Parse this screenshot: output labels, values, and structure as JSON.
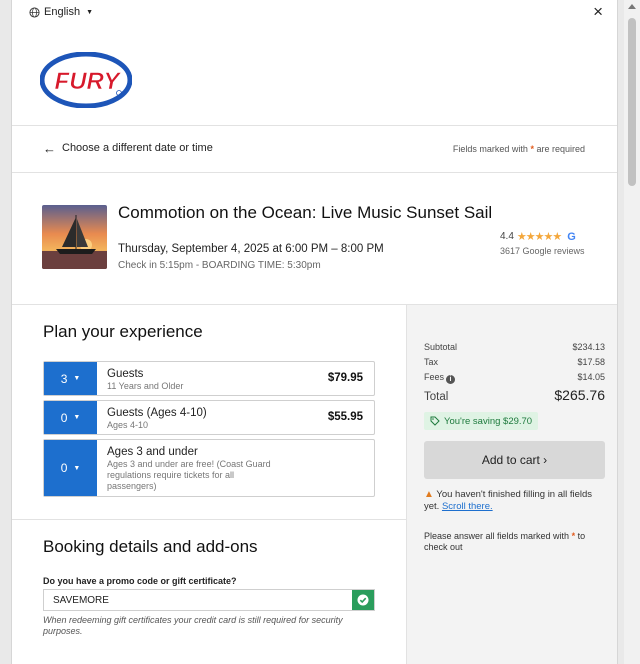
{
  "header": {
    "language": "English",
    "logo_text": "FURY"
  },
  "nav": {
    "back_label": "Choose a different date or time",
    "required_prefix": "Fields marked with",
    "required_star": "*",
    "required_suffix": "are required"
  },
  "event": {
    "title": "Commotion on the Ocean: Live Music Sunset Sail",
    "date": "Thursday, September 4, 2025 at 6:00 PM – 8:00 PM",
    "checkin": "Check in 5:15pm - BOARDING TIME: 5:30pm",
    "rating": "4.4",
    "rating_value": 4.4,
    "stars": "★★★★★",
    "google_mark": "G",
    "reviews": "3617 Google reviews"
  },
  "plan": {
    "title": "Plan your experience",
    "tickets": [
      {
        "qty": "3",
        "name": "Guests",
        "sub": "11 Years and Older",
        "price": "$79.95"
      },
      {
        "qty": "0",
        "name": "Guests (Ages 4-10)",
        "sub": "Ages 4-10",
        "price": "$55.95"
      },
      {
        "qty": "0",
        "name": "Ages 3 and under",
        "sub": "Ages 3 and under are free! (Coast Guard regulations require tickets for all passengers)",
        "price": ""
      }
    ]
  },
  "booking": {
    "title": "Booking details and add-ons",
    "promo_label": "Do you have a promo code or gift certificate?",
    "promo_value": "SAVEMORE",
    "promo_note": "When redeeming gift certificates your credit card is still required for security purposes."
  },
  "summary": {
    "subtotal_label": "Subtotal",
    "subtotal": "$234.13",
    "tax_label": "Tax",
    "tax": "$17.58",
    "fees_label": "Fees",
    "fees": "$14.05",
    "total_label": "Total",
    "total": "$265.76",
    "saving": "You're saving $29.70",
    "add_to_cart": "Add to cart ›",
    "warn_text": "You haven't finished filling in all fields yet.",
    "warn_link": "Scroll there.",
    "answer_prefix": "Please answer all fields marked with",
    "answer_star": "*",
    "answer_suffix": "to check out"
  },
  "colors": {
    "accent_blue": "#1d6fce",
    "success_green": "#2a9d5c",
    "warning_orange": "#e07b1f",
    "brand_red": "#d7192b"
  }
}
